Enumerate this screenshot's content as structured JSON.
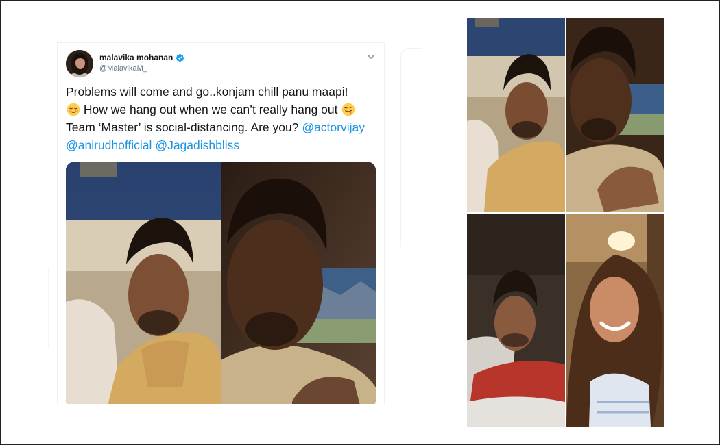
{
  "tweet": {
    "author_name": "malavika mohanan",
    "author_handle": "@MalavikaM_",
    "verified": true,
    "text_line1": "Problems will come and go..konjam chill panu maapi!",
    "text_line2": " How we hang out when we can’t really hang out ",
    "text_line3": "Team ‘Master’ is social-distancing. Are you? ",
    "mentions": [
      "@actorvijay",
      "@anirudhofficial",
      "@Jagadishbliss"
    ],
    "emojis": [
      "relieved-face-emoji",
      "face-savoring-food-emoji"
    ],
    "accent_color": "#1b95e0"
  },
  "icons": {
    "verified": "verified-badge-icon",
    "menu": "chevron-down-icon"
  }
}
